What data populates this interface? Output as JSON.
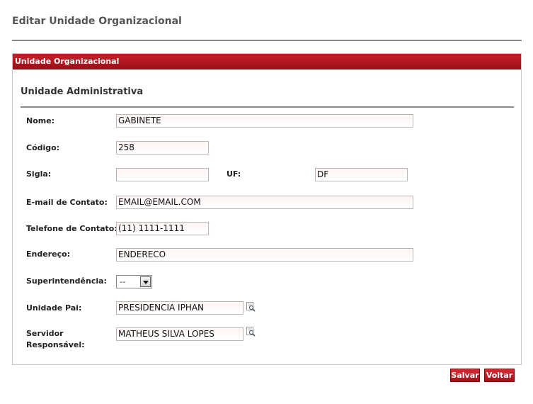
{
  "page": {
    "title": "Editar Unidade Organizacional"
  },
  "panel": {
    "header": "Unidade Organizacional",
    "section_title": "Unidade Administrativa"
  },
  "form": {
    "nome": {
      "label": "Nome:",
      "value": "GABINETE"
    },
    "codigo": {
      "label": "Código:",
      "value": "258"
    },
    "sigla": {
      "label": "Sigla:",
      "value": ""
    },
    "uf": {
      "label": "UF:",
      "value": "DF"
    },
    "email": {
      "label": "E-mail de Contato:",
      "value": "EMAIL@EMAIL.COM"
    },
    "telefone": {
      "label": "Telefone de Contato:",
      "value": "(11) 1111-1111"
    },
    "endereco": {
      "label": "Endereço:",
      "value": "ENDERECO"
    },
    "superintendencia": {
      "label": "Superintendência:",
      "value": "--"
    },
    "unidade_pai": {
      "label": "Unidade Pai:",
      "value": "PRESIDENCIA  IPHAN"
    },
    "servidor": {
      "label_line1": "Servidor",
      "label_line2": "Responsável:",
      "value": "MATHEUS SILVA LOPES"
    }
  },
  "actions": {
    "save_label": "Salvar",
    "back_label": "Voltar"
  },
  "colors": {
    "accent": "#b3161f",
    "rule": "#8a8a8a"
  },
  "icons": {
    "lookup": "magnifier-document-icon",
    "dropdown": "chevron-down-icon"
  }
}
